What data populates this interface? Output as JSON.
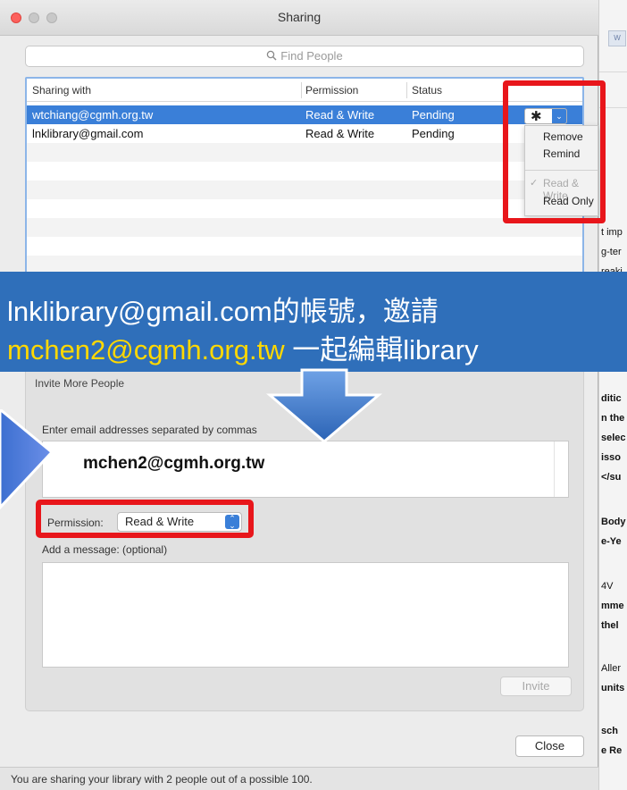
{
  "window": {
    "title": "Sharing",
    "search_placeholder": "Find People"
  },
  "table": {
    "headers": [
      "Sharing with",
      "Permission",
      "Status"
    ],
    "rows": [
      {
        "email": "wtchiang@cgmh.org.tw",
        "permission": "Read & Write",
        "status": "Pending",
        "selected": true
      },
      {
        "email": "lnklibrary@gmail.com",
        "permission": "Read & Write",
        "status": "Pending",
        "selected": false
      }
    ]
  },
  "context_menu": {
    "items": [
      "Remove",
      "Remind",
      "Read & Write",
      "Read Only"
    ],
    "checked_item": "Read & Write"
  },
  "banner": {
    "line1": "lnklibrary@gmail.com的帳號，邀請",
    "line2_email": "mchen2@cgmh.org.tw",
    "line2_rest": " 一起編輯library"
  },
  "invite": {
    "section_title": "Invite More People",
    "email_label": "Enter email addresses separated by commas",
    "email_value": "mchen2@cgmh.org.tw",
    "permission_label": "Permission:",
    "permission_value": "Read & Write",
    "message_label": "Add a message: (optional)",
    "invite_button": "Invite"
  },
  "close_button": "Close",
  "status_text": "You are sharing your library with 2 people out of a possible 100.",
  "background_doc_lines": [
    "t imp",
    "g-ter",
    "reaki",
    "ditic",
    "n the",
    "selec",
    "isso",
    "</su",
    "Body",
    "e-Ye",
    "4V",
    "mme",
    "thel",
    "Aller",
    "units",
    "sch",
    "e Re"
  ],
  "colors": {
    "selection_blue": "#3a7fd8",
    "banner_blue": "#2f6fba",
    "banner_yellow": "#ffd800",
    "highlight_red": "#e8161b"
  }
}
